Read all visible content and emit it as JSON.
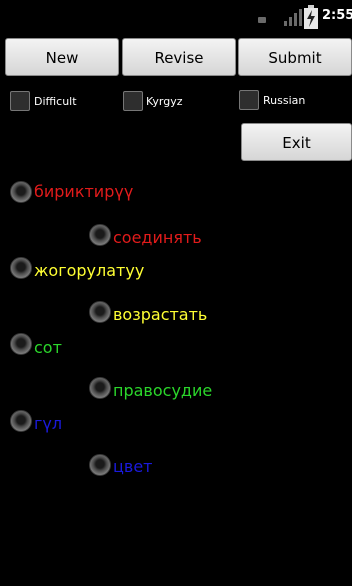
{
  "status_bar": {
    "time": "2:55"
  },
  "toolbar": {
    "new_label": "New",
    "revise_label": "Revise",
    "submit_label": "Submit",
    "exit_label": "Exit"
  },
  "options": {
    "difficult": "Difficult",
    "kyrgyz": "Kyrgyz",
    "russian": "Russian"
  },
  "quiz": {
    "items": [
      {
        "word": "бириктирүү",
        "translation": "соединять",
        "color": "#e11b1b"
      },
      {
        "word": "жогорулатуу",
        "translation": "возрастать",
        "color": "#ffff33"
      },
      {
        "word": "сот",
        "translation": "правосудие",
        "color": "#2bd62b"
      },
      {
        "word": "гүл",
        "translation": "цвет",
        "color": "#1a1adc"
      }
    ]
  },
  "colors": {
    "background": "#000000",
    "button": "#e6e6e6"
  }
}
